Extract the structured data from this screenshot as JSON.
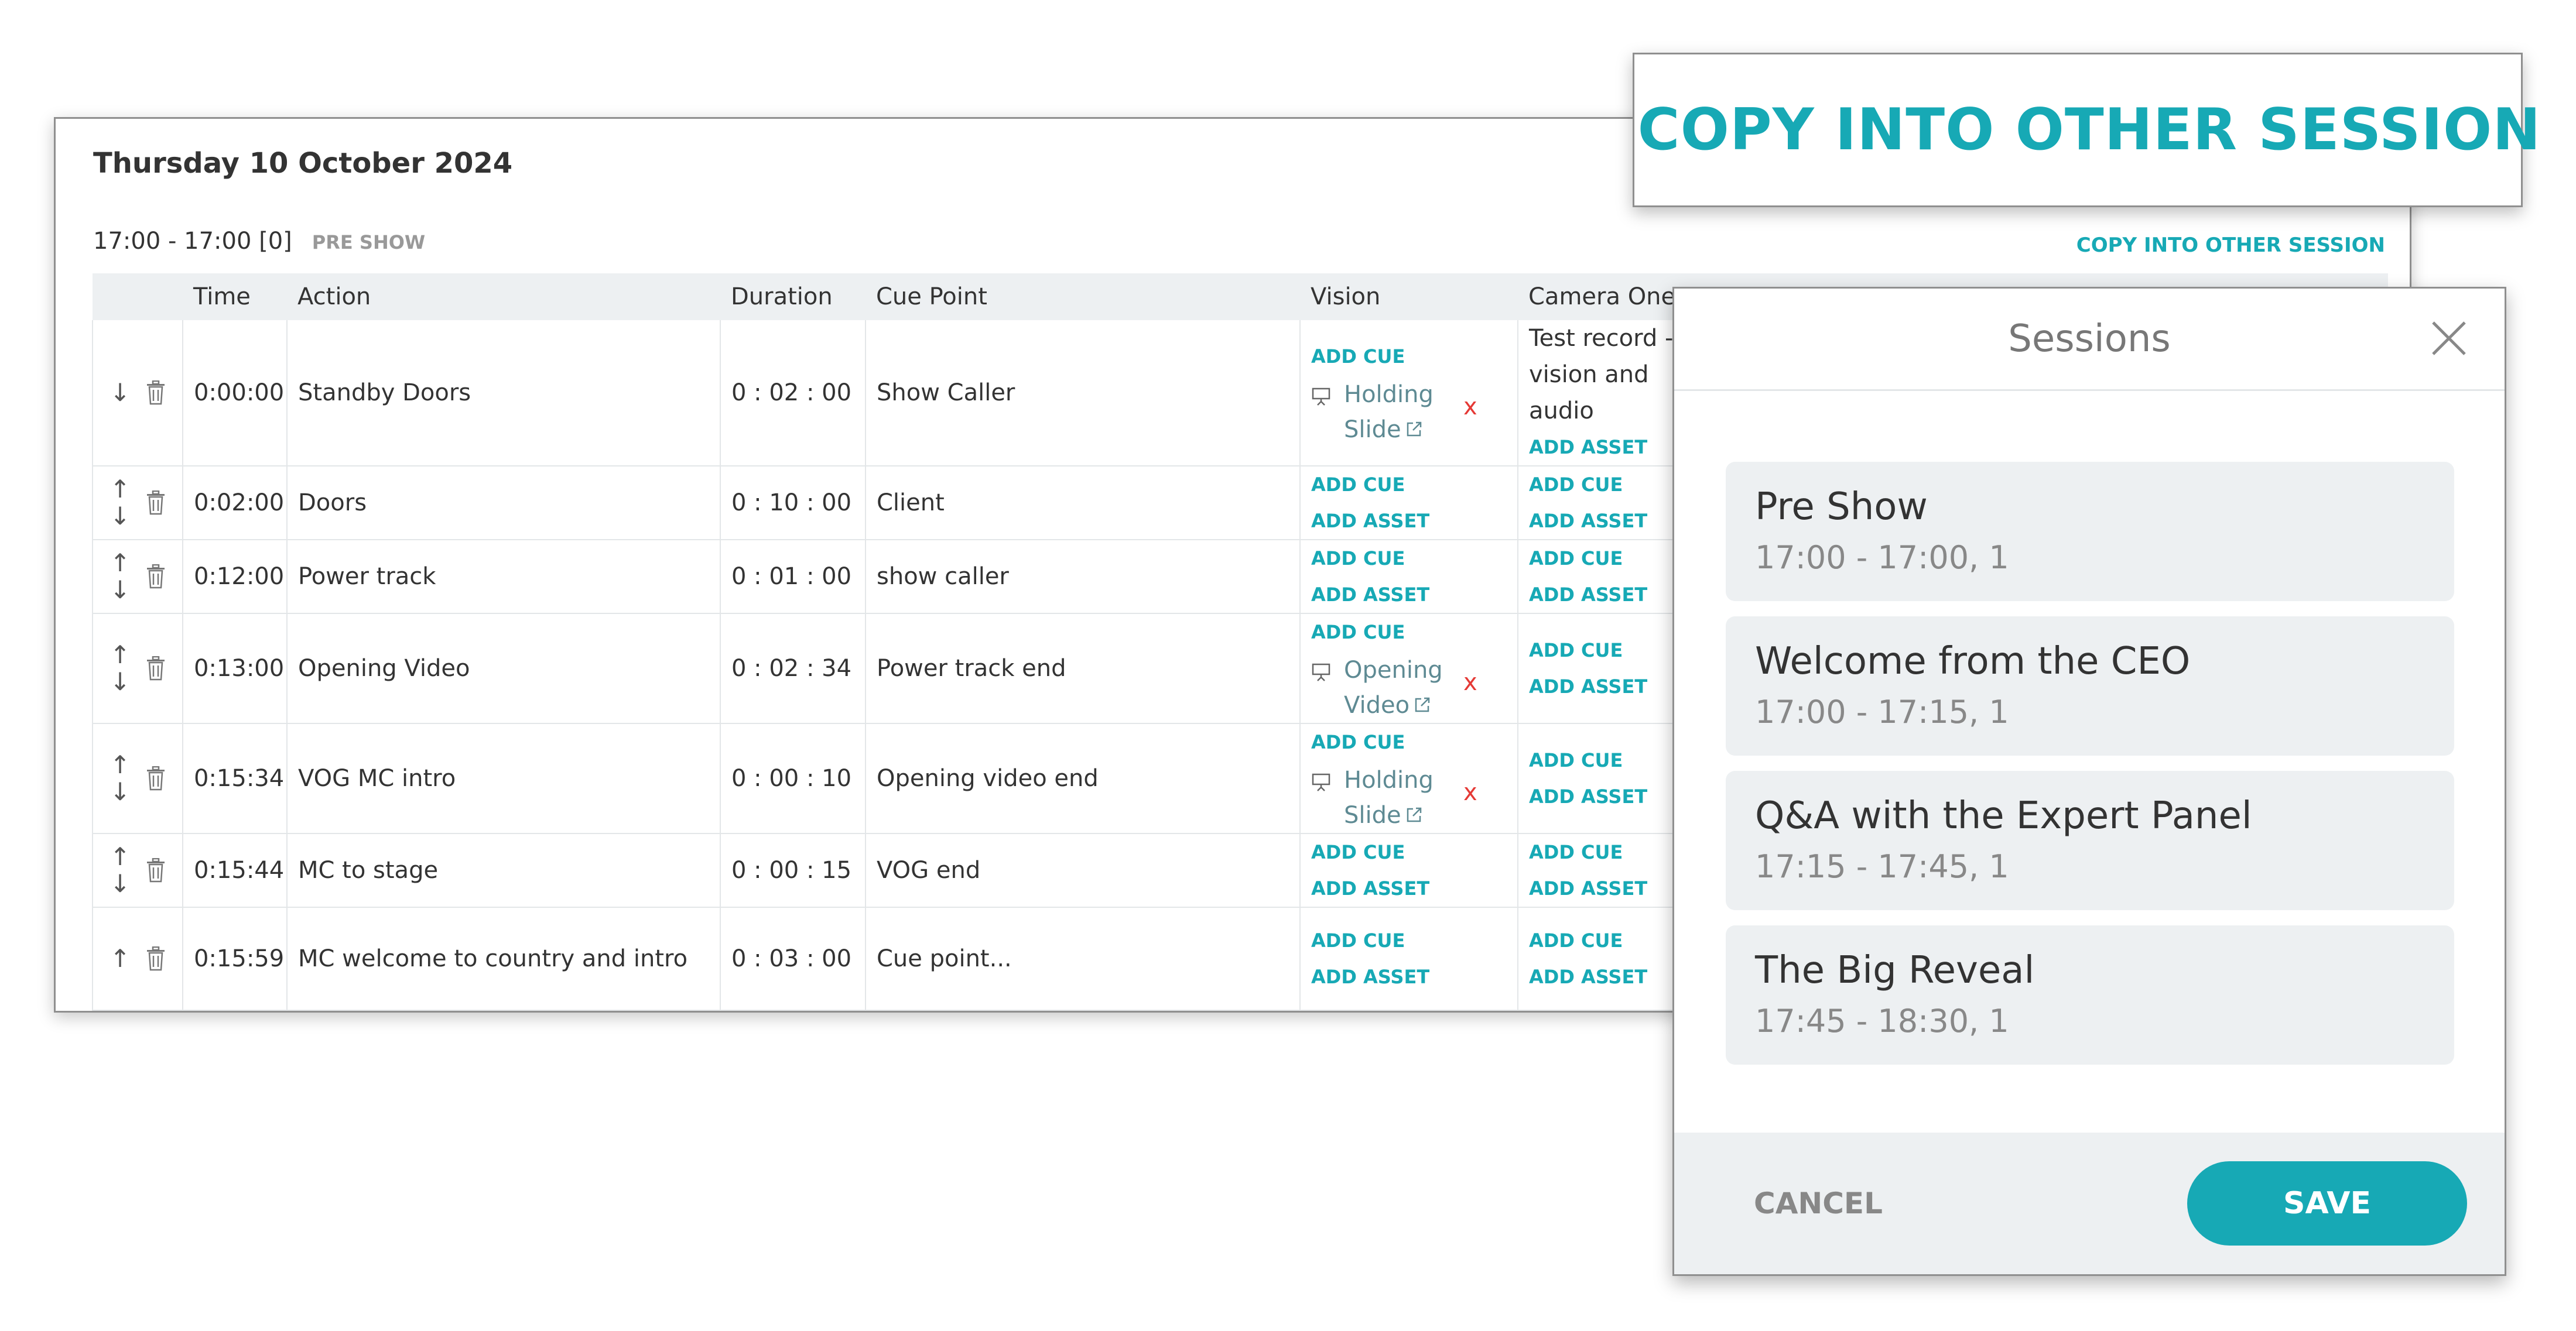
{
  "schedule": {
    "date": "Thursday 10 October 2024",
    "session_time": "17:00 - 17:00 [0]",
    "session_tag": "PRE SHOW",
    "copy_link": "COPY INTO OTHER SESSION",
    "columns": [
      "",
      "Time",
      "Action",
      "Duration",
      "Cue Point",
      "Vision",
      "Camera One"
    ],
    "add_cue_label": "ADD CUE",
    "add_asset_label": "ADD ASSET",
    "remove_label": "x",
    "rows": [
      {
        "time": "0:00:00",
        "action": "Standby Doors",
        "duration": "0 : 02 : 00",
        "cue_point": "Show Caller",
        "placeholder": false,
        "arrows": [
          "↓"
        ],
        "vision_media": "Holding Slide",
        "camera_text": "Test record - vision and audio"
      },
      {
        "time": "0:02:00",
        "action": "Doors",
        "duration": "0 : 10 : 00",
        "cue_point": "Client",
        "placeholder": false,
        "arrows": [
          "↑",
          "↓"
        ]
      },
      {
        "time": "0:12:00",
        "action": "Power track",
        "duration": "0 : 01 : 00",
        "cue_point": "show caller",
        "placeholder": false,
        "arrows": [
          "↑",
          "↓"
        ]
      },
      {
        "time": "0:13:00",
        "action": "Opening Video",
        "duration": "0 : 02 : 34",
        "cue_point": "Power track end",
        "placeholder": false,
        "arrows": [
          "↑",
          "↓"
        ],
        "vision_media": "Opening Video"
      },
      {
        "time": "0:15:34",
        "action": "VOG MC intro",
        "duration": "0 : 00 : 10",
        "cue_point": "Opening video end",
        "placeholder": false,
        "arrows": [
          "↑",
          "↓"
        ],
        "vision_media": "Holding Slide"
      },
      {
        "time": "0:15:44",
        "action": "MC to stage",
        "duration": "0 : 00 : 15",
        "cue_point": "VOG end",
        "placeholder": false,
        "arrows": [
          "↑",
          "↓"
        ]
      },
      {
        "time": "0:15:59",
        "action": "MC welcome to country and intro",
        "duration": "0 : 03 : 00",
        "cue_point": "Cue point...",
        "placeholder": true,
        "arrows": [
          "↑"
        ]
      }
    ]
  },
  "zoom_callout": {
    "text": "COPY INTO OTHER SESSION"
  },
  "modal": {
    "title": "Sessions",
    "sessions": [
      {
        "name": "Pre Show",
        "time": "17:00 - 17:00, 1"
      },
      {
        "name": "Welcome from the CEO",
        "time": "17:00 - 17:15, 1"
      },
      {
        "name": "Q&A with the Expert Panel",
        "time": "17:15 - 17:45, 1"
      },
      {
        "name": "The Big Reveal",
        "time": "17:45 - 18:30, 1"
      }
    ],
    "cancel_label": "CANCEL",
    "save_label": "SAVE"
  },
  "colors": {
    "accent": "#17a9b5",
    "remove": "#e53935",
    "header_bg": "#edf0f2"
  },
  "icons": {
    "row_delete": "trash-icon",
    "media": "presentation-icon",
    "external": "external-link-icon",
    "close": "close-icon"
  }
}
